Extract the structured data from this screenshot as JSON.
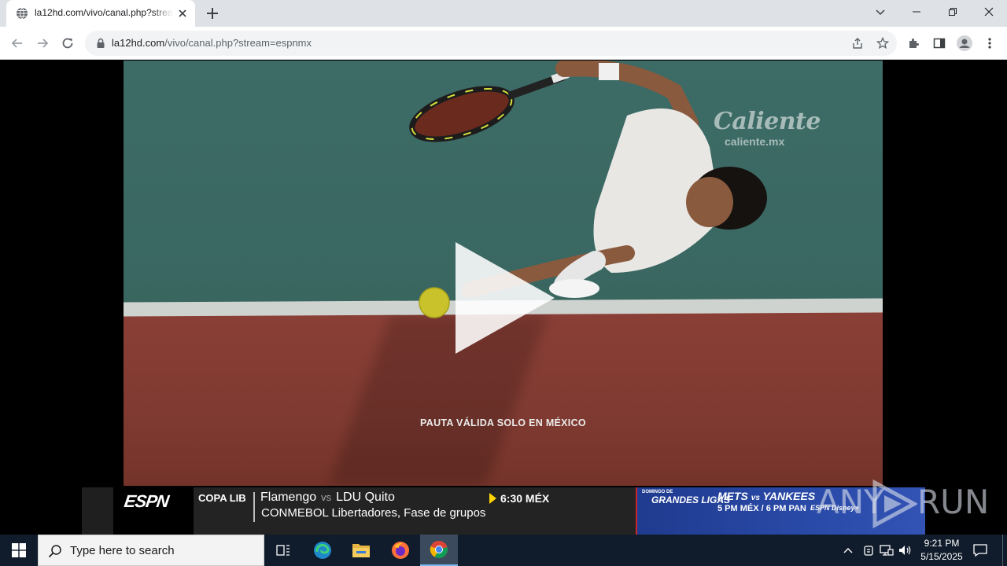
{
  "browser": {
    "tab": {
      "title": "la12hd.com/vivo/canal.php?stream=espnmx"
    },
    "omnibox": {
      "host": "la12hd.com",
      "path": "/vivo/canal.php?stream=espnmx"
    }
  },
  "video": {
    "watermark_brand": "Caliente",
    "watermark_url": "caliente.mx",
    "disclaimer": "PAUTA VÁLIDA SOLO EN MÉXICO"
  },
  "ticker": {
    "network": "ESPN",
    "league": "COPA LIB",
    "team_home": "Flamengo",
    "vs": "vs",
    "team_away": "LDU Quito",
    "time": "6:30 MÉX",
    "subtitle": "CONMEBOL Libertadores, Fase de grupos",
    "promo": {
      "tag": "DOMINGO DE",
      "title": "GRANDES LIGAS",
      "team1": "METS",
      "vs": "vs",
      "team2": "YANKEES",
      "times": "5 PM MÉX / 6 PM PAN",
      "logos": "ESPN  Disney+"
    }
  },
  "overlay": {
    "brand_left": "ANY",
    "brand_right": "RUN"
  },
  "taskbar": {
    "search_placeholder": "Type here to search",
    "time": "9:21 PM",
    "date": "5/15/2025"
  },
  "colors": {
    "tabstrip": "#dee1e6",
    "court_green": "#3d6b66",
    "court_red": "#8a3f36",
    "ticker_dark": "#232323",
    "promo_blue": "#2a4aa8",
    "taskbar": "#101c2b"
  }
}
